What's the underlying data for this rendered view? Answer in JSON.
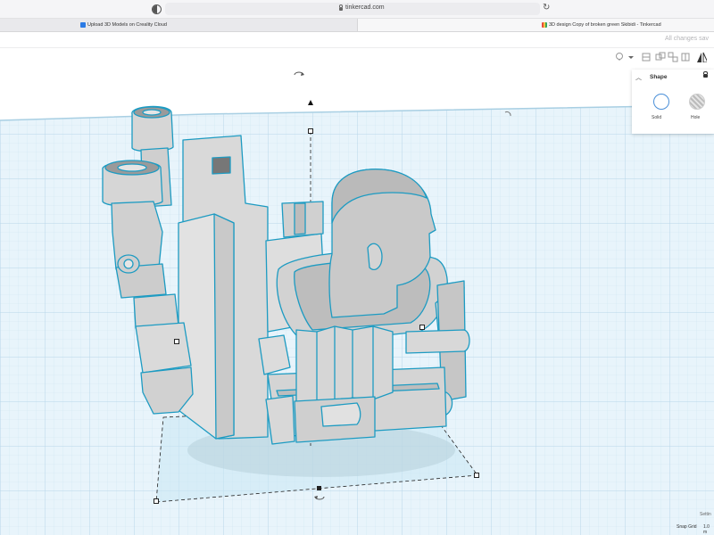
{
  "browser": {
    "url": "tinkercad.com",
    "tabs": [
      {
        "label": "Upload 3D Models on Creality Cloud"
      },
      {
        "label": "3D design Copy of broken green Skibidi - Tinkercad"
      }
    ]
  },
  "header": {
    "status": "All changes sav"
  },
  "shape_panel": {
    "title": "Shape",
    "solid_label": "Solid",
    "hole_label": "Hole",
    "selected_color": "#ffffff"
  },
  "footer": {
    "settings_label": "Settin",
    "snap_grid_label": "Snap Grid",
    "snap_grid_value": "1.0 m"
  },
  "colors": {
    "grid_background": "#e8f4fb",
    "selection_outline": "#1d9bc2",
    "model_fill": "#d9d9d9"
  }
}
